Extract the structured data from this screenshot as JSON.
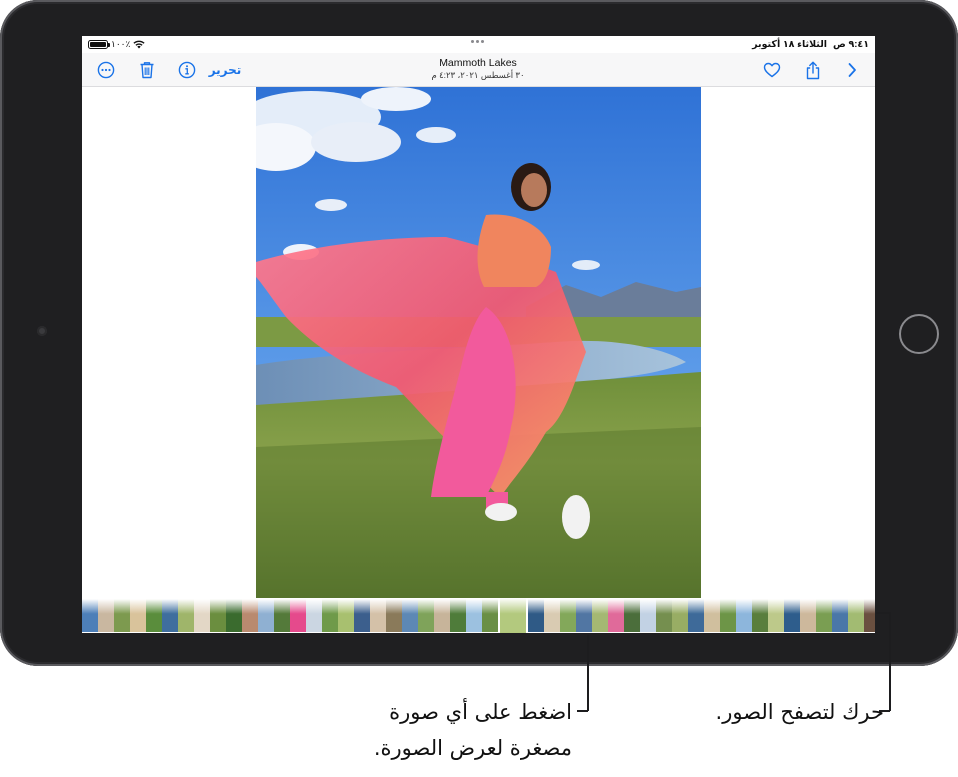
{
  "status_bar": {
    "time": "٩:٤١ ص",
    "date": "الثلاثاء ١٨ أكتوبر",
    "battery_percent": "١٠٠٪",
    "battery_level": 1.0
  },
  "toolbar": {
    "title": "Mammoth Lakes",
    "subtitle": "٣٠ أغسطس ٢٠٢١، ٤:٢٣ م",
    "edit_label": "تحرير",
    "icons": [
      "chevron-right-icon",
      "share-icon",
      "heart-icon",
      "info-icon",
      "trash-icon",
      "more-icon"
    ]
  },
  "filmstrip": {
    "thumbnail_colors": [
      "#4d7fb8",
      "#c9b7a0",
      "#7d9a4f",
      "#d9c39b",
      "#5a8d3c",
      "#3f6e9e",
      "#9fb56a",
      "#e3d7c6",
      "#6b8e3f",
      "#3a6b2e",
      "#b98a6f",
      "#8fb0d2",
      "#547a3a",
      "#e54a8c",
      "#cbd6e2",
      "#6f9a4a",
      "#a8c06f",
      "#3c5f8d",
      "#d4c1a8",
      "#8a7a5a",
      "#5d88b5",
      "#7fa35a",
      "#c7b49a",
      "#4f7c3a",
      "#9cc1e0",
      "#6a8f45",
      "#b3c97e",
      "#2f5a86",
      "#d9cbb2",
      "#83a85a",
      "#5176a3",
      "#a4b873",
      "#e06a9a",
      "#4b6e3b",
      "#c2d2e4",
      "#758f4f",
      "#98ad64",
      "#3e6a99",
      "#d0bf9e",
      "#6d9547",
      "#8db6dc",
      "#597e3d",
      "#bdc98a",
      "#2e5d8c",
      "#cdb89c",
      "#7a9e52",
      "#4a77a8",
      "#a2bb72",
      "#6a5040",
      "#101010",
      "#3b2a20"
    ],
    "selected_index": 26
  },
  "callouts": {
    "scrub": "حرك لتصفح الصور.",
    "tap_line1": "اضغط على أي صورة",
    "tap_line2": "مصغرة لعرض الصورة."
  }
}
